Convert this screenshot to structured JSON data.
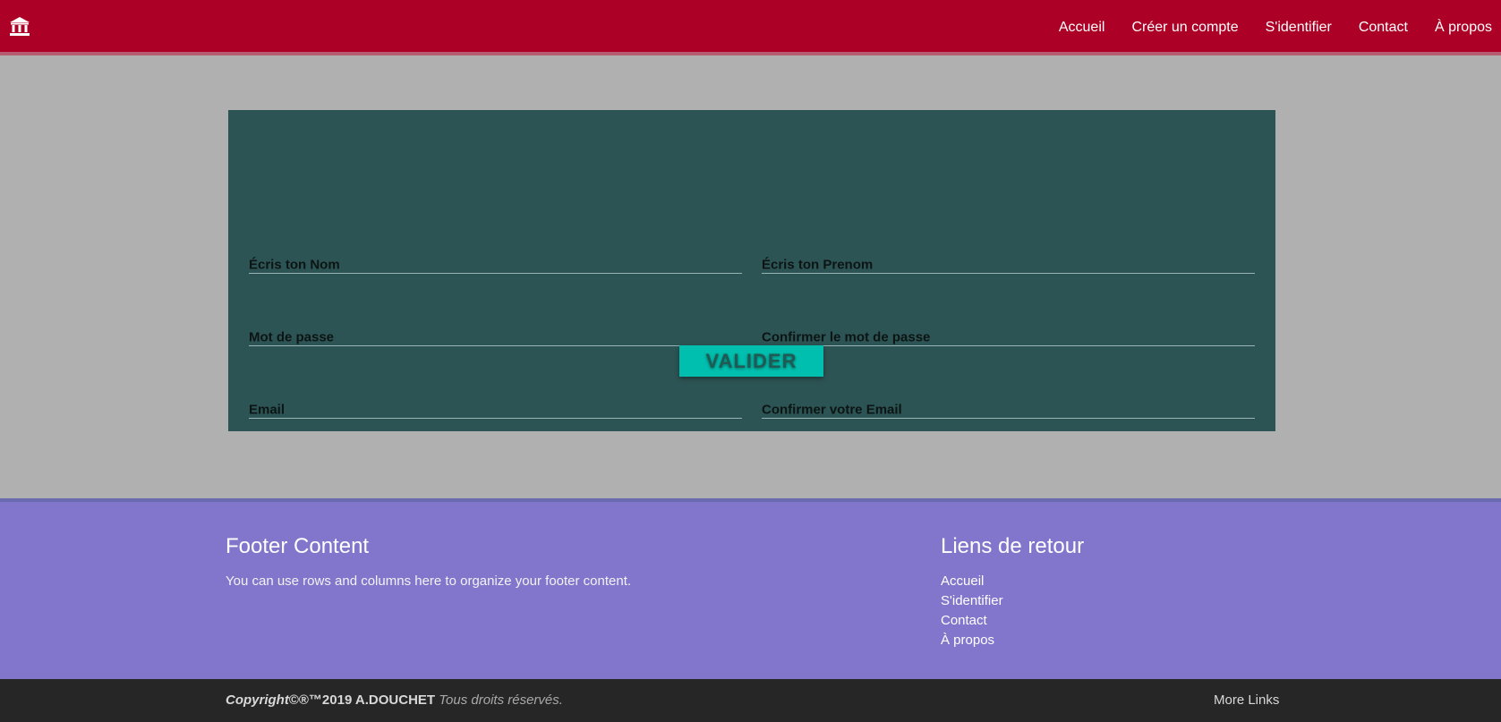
{
  "nav": {
    "logo_icon": "bank-icon",
    "colors": {
      "background": "#ad0026",
      "text": "#ffffff"
    },
    "links": [
      {
        "label": "Accueil"
      },
      {
        "label": "Créer un compte"
      },
      {
        "label": "S'identifier"
      },
      {
        "label": "Contact"
      },
      {
        "label": "À propos"
      }
    ]
  },
  "form": {
    "colors": {
      "background": "#2d5454",
      "button": "#00bfae"
    },
    "fields": {
      "nom": {
        "label": "Écris ton Nom",
        "value": ""
      },
      "prenom": {
        "label": "Écris ton Prenom",
        "value": ""
      },
      "password": {
        "label": "Mot de passe",
        "value": ""
      },
      "password_confirm": {
        "label": "Confirmer le mot de passe",
        "value": ""
      },
      "email": {
        "label": "Email",
        "value": ""
      },
      "email_confirm": {
        "label": "Confirmer votre Email",
        "value": ""
      }
    },
    "submit_label": "VALIDER"
  },
  "footer": {
    "colors": {
      "background": "#8275cc"
    },
    "left": {
      "title": "Footer Content",
      "text": "You can use rows and columns here to organize your footer content."
    },
    "right": {
      "title": "Liens de retour",
      "links": [
        {
          "label": "Accueil"
        },
        {
          "label": "S'identifier"
        },
        {
          "label": "Contact"
        },
        {
          "label": "À propos"
        }
      ]
    }
  },
  "copyright": {
    "word": "Copyright",
    "symbols": "©®™2019 A.DOUCHET",
    "rights": "Tous droits réservés.",
    "more_links": "More Links"
  }
}
